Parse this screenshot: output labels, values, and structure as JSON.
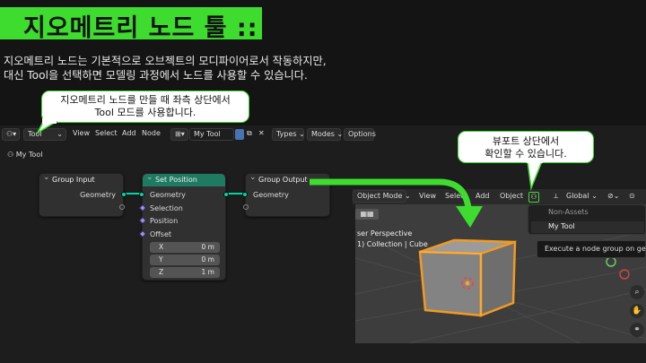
{
  "slide": {
    "title": "지오메트리 노드 툴 ::",
    "description_line1": "지오메트리 노드는 기본적으로 오브젝트의 모디파이어로서 작동하지만,",
    "description_line2": "대신 Tool을 선택하면 모델링 과정에서 노드를 사용할 수 있습니다.",
    "callout_left_line1": "지오메트리 노드를 만들 때 좌측 상단에서",
    "callout_left_line2": "Tool 모드를 사용합니다.",
    "callout_right_line1": "뷰포트 상단에서",
    "callout_right_line2": "확인할 수 있습니다.",
    "accent_color": "#3ddc2e"
  },
  "node_editor": {
    "header": {
      "mode_value": "Tool",
      "menu_view": "View",
      "menu_select": "Select",
      "menu_add": "Add",
      "menu_node": "Node",
      "tree_name": "My Tool",
      "menu_types": "Types",
      "menu_modes": "Modes",
      "menu_options": "Options"
    },
    "breadcrumb": "My Tool",
    "nodes": {
      "group_input": {
        "title": "Group Input",
        "output": "Geometry"
      },
      "set_position": {
        "title": "Set Position",
        "header_color": "#1f7a62",
        "in_geometry": "Geometry",
        "selection": "Selection",
        "position": "Position",
        "offset": "Offset",
        "x_label": "X",
        "x_value": "0 m",
        "y_label": "Y",
        "y_value": "0 m",
        "z_label": "Z",
        "z_value": "1 m"
      },
      "group_output": {
        "title": "Group Output",
        "input": "Geometry"
      }
    }
  },
  "viewport": {
    "header": {
      "mode": "Object Mode",
      "menu_view": "View",
      "menu_select": "Select",
      "menu_add": "Add",
      "menu_object": "Object",
      "orientation": "Global"
    },
    "overlay_line1": "ser Perspective",
    "overlay_line2": "1) Collection | Cube",
    "dropdown": {
      "section": "Non-Assets",
      "item": "My Tool"
    },
    "tooltip": "Execute a node group on geon"
  }
}
